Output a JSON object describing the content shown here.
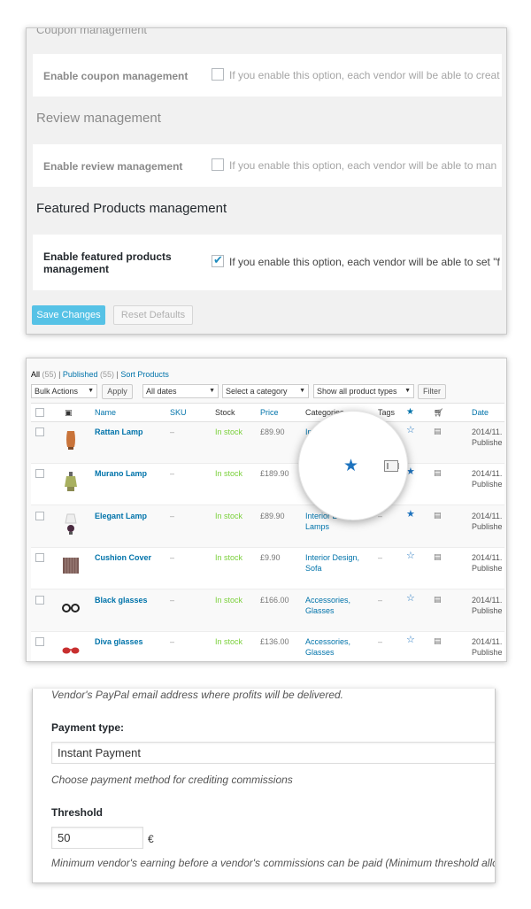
{
  "settings": {
    "clipped_heading": "Coupon management",
    "coupon": {
      "label": "Enable coupon management",
      "desc": "If you enable this option, each vendor will be able to creat",
      "checked": false
    },
    "review_section": "Review management",
    "review": {
      "label": "Enable review management",
      "desc": "If you enable this option, each vendor will be able to man",
      "checked": false
    },
    "featured_section": "Featured Products management",
    "featured": {
      "label_line1": "Enable featured products",
      "label_line2": "management",
      "desc": "If you enable this option, each vendor will be able to set \"f",
      "checked": true
    },
    "save_label": "Save Changes",
    "reset_label": "Reset Defaults"
  },
  "products": {
    "filters": {
      "all": "All",
      "all_count": "(55)",
      "published": "Published",
      "published_count": "(55)",
      "sort": "Sort Products",
      "sep": "|"
    },
    "bulk_actions": "Bulk Actions",
    "apply": "Apply",
    "all_dates": "All dates",
    "select_category": "Select a category",
    "product_types": "Show all product types",
    "filter": "Filter",
    "columns": {
      "name": "Name",
      "sku": "SKU",
      "stock": "Stock",
      "price": "Price",
      "categories": "Categories",
      "tags": "Tags",
      "date": "Date"
    },
    "rows": [
      {
        "name": "Rattan Lamp",
        "sku": "–",
        "stock": "In stock",
        "price": "£89.90",
        "cat1": "Inter",
        "cat2": "",
        "tags": "",
        "featured": false,
        "date": "2014/11.",
        "status": "Publishe"
      },
      {
        "name": "Murano Lamp",
        "sku": "–",
        "stock": "In stock",
        "price": "£189.90",
        "cat1": "",
        "cat2": "",
        "tags": "",
        "featured": true,
        "date": "2014/11.",
        "status": "Publishe"
      },
      {
        "name": "Elegant Lamp",
        "sku": "–",
        "stock": "In stock",
        "price": "£89.90",
        "cat1": "Interior Design,",
        "cat2": "Lamps",
        "tags": "–",
        "featured": true,
        "date": "2014/11.",
        "status": "Publishe"
      },
      {
        "name": "Cushion Cover",
        "sku": "–",
        "stock": "In stock",
        "price": "£9.90",
        "cat1": "Interior Design,",
        "cat2": "Sofa",
        "tags": "–",
        "featured": false,
        "date": "2014/11.",
        "status": "Publishe"
      },
      {
        "name": "Black glasses",
        "sku": "–",
        "stock": "In stock",
        "price": "£166.00",
        "cat1": "Accessories,",
        "cat2": "Glasses",
        "tags": "–",
        "featured": false,
        "date": "2014/11.",
        "status": "Publishe"
      },
      {
        "name": "Diva glasses",
        "sku": "–",
        "stock": "In stock",
        "price": "£136.00",
        "cat1": "Accessories,",
        "cat2": "Glasses",
        "tags": "–",
        "featured": false,
        "date": "2014/11.",
        "status": "Publishe"
      }
    ]
  },
  "payment": {
    "paypal_desc": "Vendor's PayPal email address where profits will be delivered.",
    "type_label": "Payment type:",
    "type_value": "Instant Payment",
    "type_desc": "Choose payment method for crediting commissions",
    "threshold_label": "Threshold",
    "threshold_value": "50",
    "currency": "€",
    "threshold_desc": "Minimum vendor's earning before a vendor's commissions can be paid (Minimum threshold allowed"
  },
  "colors": {
    "accent": "#0073aa",
    "primary_button": "#56c2e6",
    "in_stock": "#7ad03a",
    "star": "#1e73be"
  }
}
